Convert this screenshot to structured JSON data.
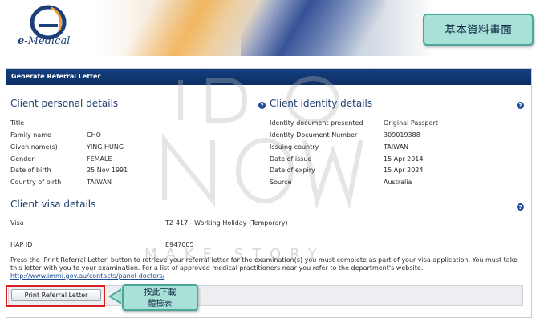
{
  "brand": {
    "logo_prefix": "e",
    "logo_name": "Medical"
  },
  "annotation_label": "基本資料畫面",
  "panel_title": "Generate Referral Letter",
  "watermark": {
    "big": "IDONOW",
    "sub": "MAKE STORY"
  },
  "personal": {
    "title": "Client personal details",
    "rows": [
      {
        "label": "Title",
        "value": ""
      },
      {
        "label": "Family name",
        "value": "CHO"
      },
      {
        "label": "Given name(s)",
        "value": "YING HUNG"
      },
      {
        "label": "Gender",
        "value": "FEMALE"
      },
      {
        "label": "Date of birth",
        "value": "25 Nov 1991"
      },
      {
        "label": "Country of birth",
        "value": "TAIWAN"
      }
    ]
  },
  "identity": {
    "title": "Client identity details",
    "rows": [
      {
        "label": "Identity document presented",
        "value": "Original Passport"
      },
      {
        "label": "Identity Document Number",
        "value": "309019388"
      },
      {
        "label": "Issuing country",
        "value": "TAIWAN"
      },
      {
        "label": "Date of issue",
        "value": "15 Apr 2014"
      },
      {
        "label": "Date of expiry",
        "value": "15 Apr 2024"
      },
      {
        "label": "Source",
        "value": "Australia"
      }
    ]
  },
  "visa": {
    "title": "Client visa details",
    "visa_label": "Visa",
    "visa_value": "TZ 417 - Working Holiday (Temporary)",
    "hap_label": "HAP ID",
    "hap_value": "E947005"
  },
  "instructions": {
    "text": "Press the 'Print Referral Letter' button to retrieve your referral letter for the examination(s) you must complete as part of your visa application. You must take this letter with you to your examination. For a list of approved medical practitioners near you refer to the department's website.",
    "link": "http://www.immi.gov.au/contacts/panel-doctors/"
  },
  "print_button": "Print Referral Letter",
  "callout": {
    "line1": "按此下載",
    "line2": "體檢表"
  },
  "help_glyph": "?"
}
